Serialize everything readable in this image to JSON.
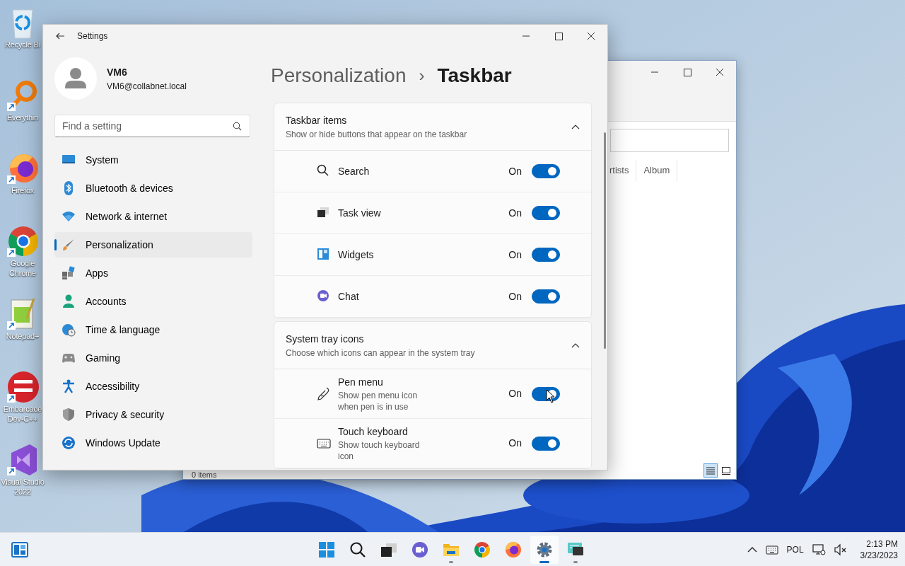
{
  "desktop_icons": [
    {
      "kind": "recycle",
      "lines": [
        "Recycle Bi"
      ],
      "shortcut": false
    },
    {
      "kind": "everything",
      "lines": [
        "Everythin"
      ],
      "shortcut": true
    },
    {
      "kind": "firefox",
      "lines": [
        "Firefox"
      ],
      "shortcut": true
    },
    {
      "kind": "chrome",
      "lines": [
        "Google",
        "Chrome"
      ],
      "shortcut": true
    },
    {
      "kind": "notepad",
      "lines": [
        "Notepad+"
      ],
      "shortcut": true
    },
    {
      "kind": "devcpp",
      "lines": [
        "Embarcade",
        "Dev-C++"
      ],
      "shortcut": true
    },
    {
      "kind": "vs",
      "lines": [
        "Visual Studio",
        "2022"
      ],
      "shortcut": true
    }
  ],
  "background_window": {
    "columns": [
      "rtists",
      "Album"
    ],
    "status": "0 items",
    "view_buttons": [
      {
        "kind": "details",
        "selected": true
      },
      {
        "kind": "tiles",
        "selected": false
      }
    ]
  },
  "settings": {
    "title": "Settings",
    "user": {
      "name": "VM6",
      "email": "VM6@collabnet.local"
    },
    "search": {
      "placeholder": "Find a setting"
    },
    "nav": [
      {
        "kind": "system",
        "label": "System",
        "selected": false
      },
      {
        "kind": "bluetooth",
        "label": "Bluetooth & devices",
        "selected": false
      },
      {
        "kind": "network",
        "label": "Network & internet",
        "selected": false
      },
      {
        "kind": "personalization",
        "label": "Personalization",
        "selected": true
      },
      {
        "kind": "apps",
        "label": "Apps",
        "selected": false
      },
      {
        "kind": "accounts",
        "label": "Accounts",
        "selected": false
      },
      {
        "kind": "time",
        "label": "Time & language",
        "selected": false
      },
      {
        "kind": "gaming",
        "label": "Gaming",
        "selected": false
      },
      {
        "kind": "accessibility",
        "label": "Accessibility",
        "selected": false
      },
      {
        "kind": "privacy",
        "label": "Privacy & security",
        "selected": false
      },
      {
        "kind": "update",
        "label": "Windows Update",
        "selected": false
      }
    ],
    "breadcrumb": {
      "parent": "Personalization",
      "separator": "›",
      "current": "Taskbar"
    },
    "sections": [
      {
        "title": "Taskbar items",
        "subtitle": "Show or hide buttons that appear on the taskbar",
        "expanded": true,
        "items": [
          {
            "kind": "search",
            "label": "Search",
            "state_text": "On",
            "on": true
          },
          {
            "kind": "taskview",
            "label": "Task view",
            "state_text": "On",
            "on": true
          },
          {
            "kind": "widgets",
            "label": "Widgets",
            "state_text": "On",
            "on": true
          },
          {
            "kind": "chat",
            "label": "Chat",
            "state_text": "On",
            "on": true
          }
        ]
      },
      {
        "title": "System tray icons",
        "subtitle": "Choose which icons can appear in the system tray",
        "expanded": true,
        "items": [
          {
            "kind": "pen",
            "label": "Pen menu",
            "description": "Show pen menu icon when pen is in use",
            "state_text": "On",
            "on": true
          },
          {
            "kind": "keyboard",
            "label": "Touch keyboard",
            "description": "Show touch keyboard icon",
            "state_text": "On",
            "on": true
          }
        ]
      }
    ]
  },
  "taskbar": {
    "apps": [
      {
        "kind": "start",
        "running": false,
        "active": false
      },
      {
        "kind": "search",
        "running": false,
        "active": false
      },
      {
        "kind": "taskview",
        "running": false,
        "active": false
      },
      {
        "kind": "chat",
        "running": false,
        "active": false
      },
      {
        "kind": "explorer",
        "running": true,
        "active": false
      },
      {
        "kind": "chrome",
        "running": false,
        "active": false
      },
      {
        "kind": "firefox",
        "running": false,
        "active": false
      },
      {
        "kind": "settings",
        "running": true,
        "active": true
      },
      {
        "kind": "remote",
        "running": true,
        "active": false
      }
    ],
    "language": "POL",
    "time": "2:13 PM",
    "date": "3/23/2023"
  }
}
